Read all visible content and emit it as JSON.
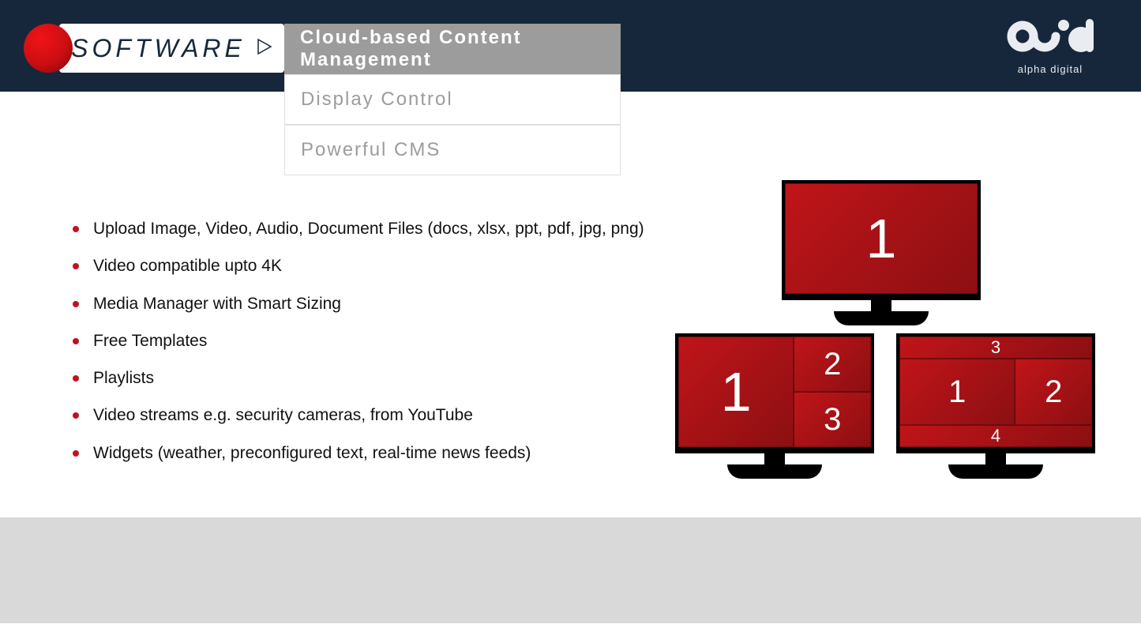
{
  "header": {
    "software_label": "SOFTWARE",
    "brand_tag": "alpha digital"
  },
  "menu": {
    "items": [
      {
        "label": "Cloud-based Content Management",
        "active": true
      },
      {
        "label": "Display Control",
        "active": false
      },
      {
        "label": "Powerful CMS",
        "active": false
      }
    ]
  },
  "features": [
    "Upload Image, Video, Audio, Document Files (docs, xlsx, ppt, pdf, jpg, png)",
    "Video compatible upto 4K",
    "Media Manager with Smart Sizing",
    "Free Templates",
    "Playlists",
    "Video streams e.g. security cameras, from YouTube",
    "Widgets (weather, preconfigured text, real-time news feeds)"
  ],
  "monitors": {
    "m1": {
      "zones": [
        "1"
      ]
    },
    "m2": {
      "zones": [
        "1",
        "2",
        "3"
      ]
    },
    "m3": {
      "zones": [
        "3",
        "1",
        "2",
        "4"
      ]
    }
  }
}
